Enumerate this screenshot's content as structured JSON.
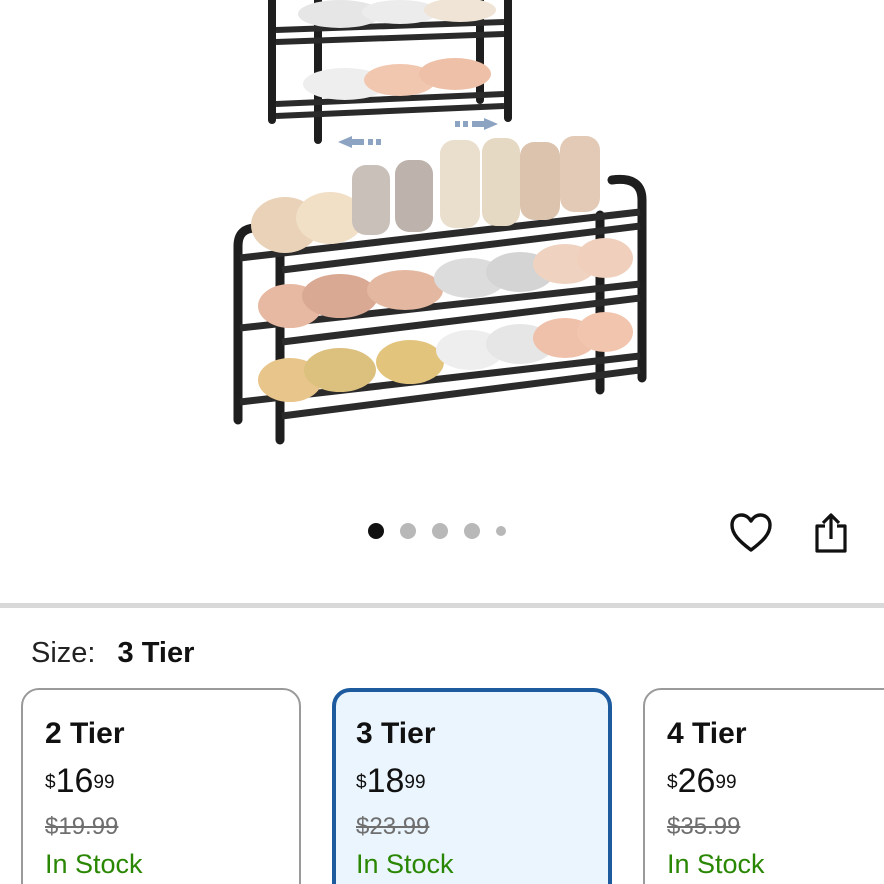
{
  "product": {
    "image_alt": "Expandable shoe rack with shoes"
  },
  "carousel": {
    "count": 5,
    "active_index": 0
  },
  "actions": {
    "favorite_icon": "heart-icon",
    "share_icon": "share-icon"
  },
  "size": {
    "label": "Size:",
    "selected": "3 Tier"
  },
  "options": [
    {
      "title": "2 Tier",
      "currency": "$",
      "dollars": "16",
      "cents": "99",
      "was": "$19.99",
      "stock": "In Stock",
      "selected": false
    },
    {
      "title": "3 Tier",
      "currency": "$",
      "dollars": "18",
      "cents": "99",
      "was": "$23.99",
      "stock": "In Stock",
      "selected": true
    },
    {
      "title": "4 Tier",
      "currency": "$",
      "dollars": "26",
      "cents": "99",
      "was": "$35.99",
      "stock": "In Stock",
      "selected": false
    }
  ],
  "colors": {
    "selected_border": "#1d5b9e",
    "selected_bg": "#eaf5fd",
    "in_stock": "#2a8703",
    "strike_price": "#6f6f6f"
  }
}
